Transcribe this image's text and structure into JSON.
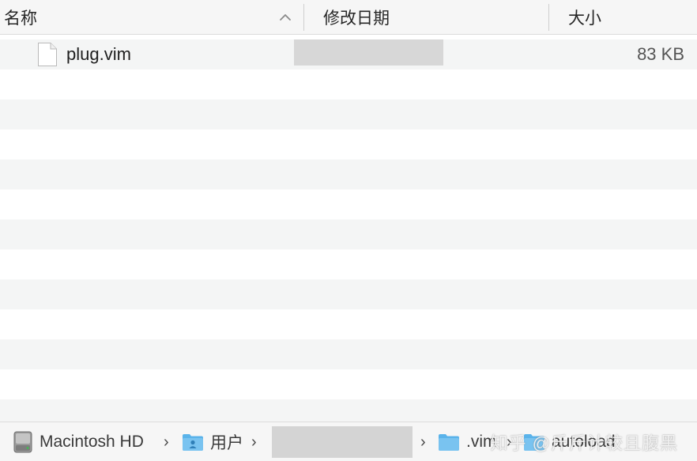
{
  "columns": {
    "name": "名称",
    "date_modified": "修改日期",
    "size": "大小"
  },
  "sort": {
    "column": "name",
    "direction": "ascending",
    "icon": "chevron-up-icon"
  },
  "files": [
    {
      "name": "plug.vim",
      "size": "83 KB",
      "icon": "document-icon"
    }
  ],
  "path": [
    {
      "label": "Macintosh HD",
      "icon": "hard-drive-icon"
    },
    {
      "label": "用户",
      "icon": "users-folder-icon"
    },
    {
      "label": "",
      "icon": "user-home-icon",
      "redacted": true
    },
    {
      "label": ".vim",
      "icon": "folder-icon"
    },
    {
      "label": "autoload",
      "icon": "folder-icon"
    }
  ],
  "watermark": "知乎 @斤斤计较且腹黑",
  "colors": {
    "row_stripe": "#f4f5f5",
    "header_bg": "#f6f6f6",
    "folder_blue": "#5ab3ea"
  }
}
